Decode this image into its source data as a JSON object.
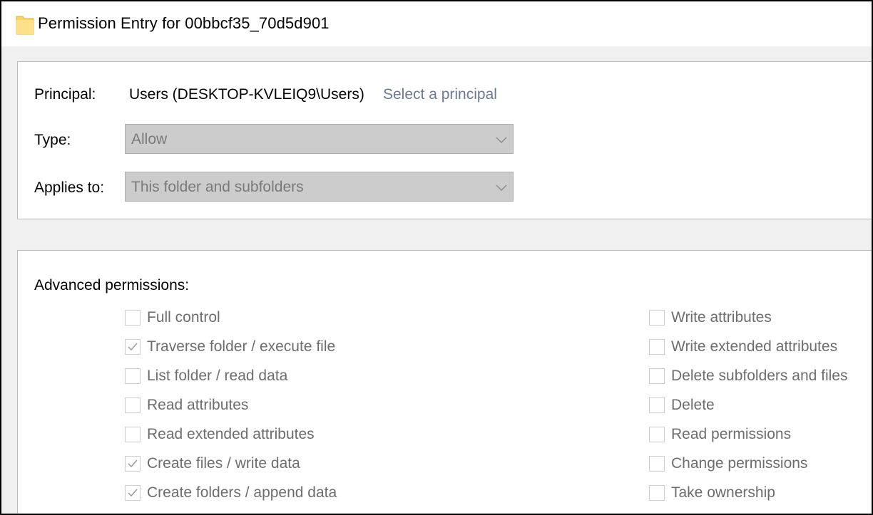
{
  "window": {
    "title": "Permission Entry for 00bbcf35_70d5d901",
    "icon": "folder-icon"
  },
  "principal": {
    "label": "Principal:",
    "value": "Users (DESKTOP-KVLEIQ9\\Users)",
    "link": "Select a principal"
  },
  "type": {
    "label": "Type:",
    "value": "Allow"
  },
  "applies_to": {
    "label": "Applies to:",
    "value": "This folder and subfolders"
  },
  "advanced": {
    "heading": "Advanced permissions:",
    "left": [
      {
        "label": "Full control",
        "checked": false
      },
      {
        "label": "Traverse folder / execute file",
        "checked": true
      },
      {
        "label": "List folder / read data",
        "checked": false
      },
      {
        "label": "Read attributes",
        "checked": false
      },
      {
        "label": "Read extended attributes",
        "checked": false
      },
      {
        "label": "Create files / write data",
        "checked": true
      },
      {
        "label": "Create folders / append data",
        "checked": true
      }
    ],
    "right": [
      {
        "label": "Write attributes",
        "checked": false
      },
      {
        "label": "Write extended attributes",
        "checked": false
      },
      {
        "label": "Delete subfolders and files",
        "checked": false
      },
      {
        "label": "Delete",
        "checked": false
      },
      {
        "label": "Read permissions",
        "checked": false
      },
      {
        "label": "Change permissions",
        "checked": false
      },
      {
        "label": "Take ownership",
        "checked": false
      }
    ]
  },
  "colors": {
    "link": "#6d7a8f",
    "disabled_text": "#6d6d6d",
    "combo_bg": "#cccccc",
    "folder": "#f6d26a"
  }
}
